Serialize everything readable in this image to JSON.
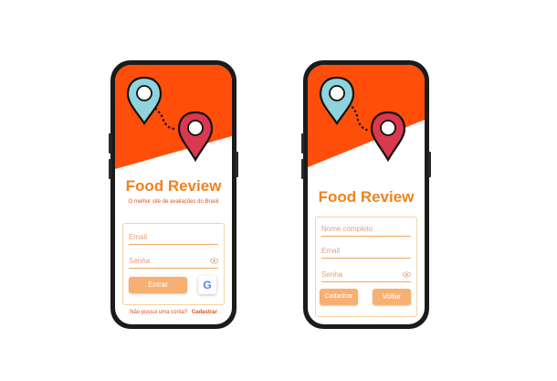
{
  "colors": {
    "accent_red": "#ff4e0a",
    "brand_orange": "#f0821e",
    "button_orange": "#f7b072",
    "pin_teal": "#8fd3dc",
    "pin_red": "#d9384f"
  },
  "login_screen": {
    "app_title": "Food Review",
    "tagline": "O melhor site de avaliações do Brasil",
    "email_placeholder": "Email",
    "password_placeholder": "Senha",
    "enter_button": "Entrar",
    "google_icon": "G",
    "no_account_text": "Não possui uma conta?",
    "register_link": "Cadastrar"
  },
  "register_screen": {
    "app_title": "Food Review",
    "fullname_placeholder": "Nome completo",
    "email_placeholder": "Email",
    "password_placeholder": "Senha",
    "register_button": "Cadastrar",
    "back_button": "Voltar"
  }
}
